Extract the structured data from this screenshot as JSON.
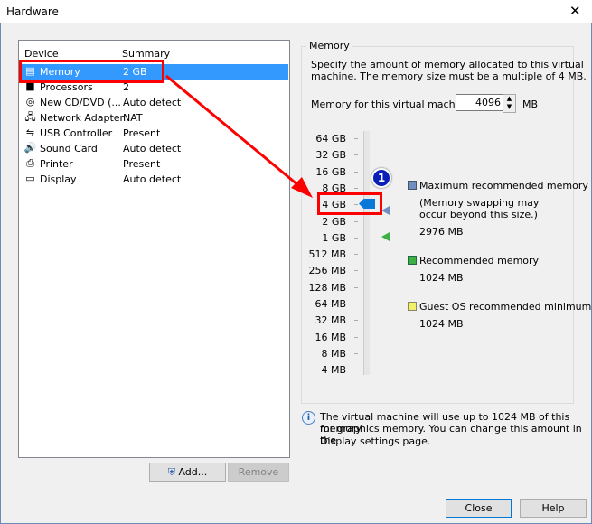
{
  "window": {
    "title": "Hardware",
    "close_glyph": "✕"
  },
  "device_list": {
    "headers": {
      "device": "Device",
      "summary": "Summary"
    },
    "items": [
      {
        "name": "Memory",
        "summary": "2 GB",
        "icon": "memory-icon",
        "glyph": "▤",
        "selected": true
      },
      {
        "name": "Processors",
        "summary": "2",
        "icon": "processor-icon",
        "glyph": "■"
      },
      {
        "name": "New CD/DVD (...",
        "summary": "Auto detect",
        "icon": "cd-dvd-icon",
        "glyph": "◎"
      },
      {
        "name": "Network Adapter",
        "summary": "NAT",
        "icon": "network-adapter-icon",
        "glyph": "🖧"
      },
      {
        "name": "USB Controller",
        "summary": "Present",
        "icon": "usb-icon",
        "glyph": "⇋"
      },
      {
        "name": "Sound Card",
        "summary": "Auto detect",
        "icon": "sound-icon",
        "glyph": "🔊"
      },
      {
        "name": "Printer",
        "summary": "Present",
        "icon": "printer-icon",
        "glyph": "⎙"
      },
      {
        "name": "Display",
        "summary": "Auto detect",
        "icon": "display-icon",
        "glyph": "▭"
      }
    ]
  },
  "buttons": {
    "add": "Add...",
    "remove": "Remove",
    "close": "Close",
    "help": "Help"
  },
  "memory": {
    "group_title": "Memory",
    "desc_1": "Specify the amount of memory allocated to this virtual",
    "desc_2": "machine. The memory size must be a multiple of 4 MB.",
    "field_label": "Memory for this virtual machine:",
    "value": "4096",
    "unit": "MB",
    "scale": [
      "64 GB",
      "32 GB",
      "16 GB",
      "8 GB",
      "4 GB",
      "2 GB",
      "1 GB",
      "512 MB",
      "256 MB",
      "128 MB",
      "64 MB",
      "32 MB",
      "16 MB",
      "8 MB",
      "4 MB"
    ],
    "legend": {
      "max_label": "Maximum recommended memory",
      "max_note_1": "(Memory swapping may",
      "max_note_2": "occur beyond this size.)",
      "max_value": "2976 MB",
      "max_color": "#6f8fc0",
      "rec_label": "Recommended memory",
      "rec_value": "1024 MB",
      "rec_color": "#3cb043",
      "min_label": "Guest OS recommended minimum",
      "min_value": "1024 MB",
      "min_color": "#f2f26a"
    },
    "info_1": "The virtual machine will use up to 1024 MB of this memory",
    "info_2": "for graphics memory. You can change this amount in the",
    "info_3": "Display settings page."
  },
  "annotation": {
    "badge": "1",
    "color": "#ff0000"
  }
}
